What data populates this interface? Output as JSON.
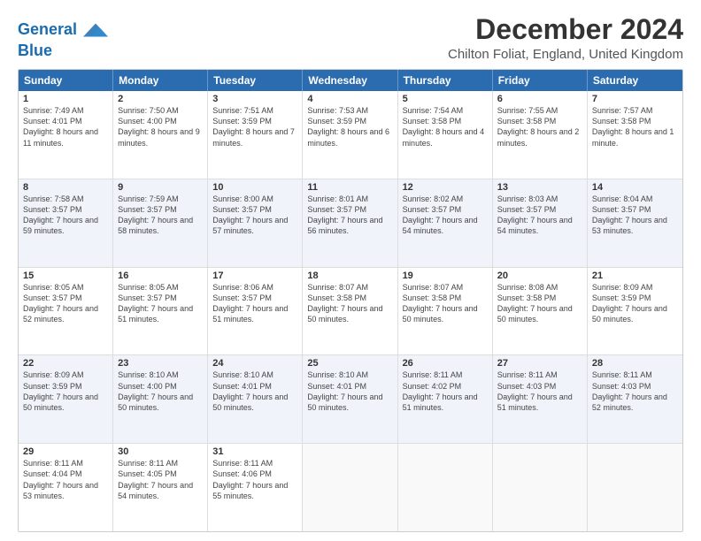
{
  "header": {
    "logo_line1": "General",
    "logo_line2": "Blue",
    "title": "December 2024",
    "subtitle": "Chilton Foliat, England, United Kingdom"
  },
  "calendar": {
    "headers": [
      "Sunday",
      "Monday",
      "Tuesday",
      "Wednesday",
      "Thursday",
      "Friday",
      "Saturday"
    ],
    "rows": [
      [
        {
          "day": "1",
          "sunrise": "Sunrise: 7:49 AM",
          "sunset": "Sunset: 4:01 PM",
          "daylight": "Daylight: 8 hours and 11 minutes."
        },
        {
          "day": "2",
          "sunrise": "Sunrise: 7:50 AM",
          "sunset": "Sunset: 4:00 PM",
          "daylight": "Daylight: 8 hours and 9 minutes."
        },
        {
          "day": "3",
          "sunrise": "Sunrise: 7:51 AM",
          "sunset": "Sunset: 3:59 PM",
          "daylight": "Daylight: 8 hours and 7 minutes."
        },
        {
          "day": "4",
          "sunrise": "Sunrise: 7:53 AM",
          "sunset": "Sunset: 3:59 PM",
          "daylight": "Daylight: 8 hours and 6 minutes."
        },
        {
          "day": "5",
          "sunrise": "Sunrise: 7:54 AM",
          "sunset": "Sunset: 3:58 PM",
          "daylight": "Daylight: 8 hours and 4 minutes."
        },
        {
          "day": "6",
          "sunrise": "Sunrise: 7:55 AM",
          "sunset": "Sunset: 3:58 PM",
          "daylight": "Daylight: 8 hours and 2 minutes."
        },
        {
          "day": "7",
          "sunrise": "Sunrise: 7:57 AM",
          "sunset": "Sunset: 3:58 PM",
          "daylight": "Daylight: 8 hours and 1 minute."
        }
      ],
      [
        {
          "day": "8",
          "sunrise": "Sunrise: 7:58 AM",
          "sunset": "Sunset: 3:57 PM",
          "daylight": "Daylight: 7 hours and 59 minutes."
        },
        {
          "day": "9",
          "sunrise": "Sunrise: 7:59 AM",
          "sunset": "Sunset: 3:57 PM",
          "daylight": "Daylight: 7 hours and 58 minutes."
        },
        {
          "day": "10",
          "sunrise": "Sunrise: 8:00 AM",
          "sunset": "Sunset: 3:57 PM",
          "daylight": "Daylight: 7 hours and 57 minutes."
        },
        {
          "day": "11",
          "sunrise": "Sunrise: 8:01 AM",
          "sunset": "Sunset: 3:57 PM",
          "daylight": "Daylight: 7 hours and 56 minutes."
        },
        {
          "day": "12",
          "sunrise": "Sunrise: 8:02 AM",
          "sunset": "Sunset: 3:57 PM",
          "daylight": "Daylight: 7 hours and 54 minutes."
        },
        {
          "day": "13",
          "sunrise": "Sunrise: 8:03 AM",
          "sunset": "Sunset: 3:57 PM",
          "daylight": "Daylight: 7 hours and 54 minutes."
        },
        {
          "day": "14",
          "sunrise": "Sunrise: 8:04 AM",
          "sunset": "Sunset: 3:57 PM",
          "daylight": "Daylight: 7 hours and 53 minutes."
        }
      ],
      [
        {
          "day": "15",
          "sunrise": "Sunrise: 8:05 AM",
          "sunset": "Sunset: 3:57 PM",
          "daylight": "Daylight: 7 hours and 52 minutes."
        },
        {
          "day": "16",
          "sunrise": "Sunrise: 8:05 AM",
          "sunset": "Sunset: 3:57 PM",
          "daylight": "Daylight: 7 hours and 51 minutes."
        },
        {
          "day": "17",
          "sunrise": "Sunrise: 8:06 AM",
          "sunset": "Sunset: 3:57 PM",
          "daylight": "Daylight: 7 hours and 51 minutes."
        },
        {
          "day": "18",
          "sunrise": "Sunrise: 8:07 AM",
          "sunset": "Sunset: 3:58 PM",
          "daylight": "Daylight: 7 hours and 50 minutes."
        },
        {
          "day": "19",
          "sunrise": "Sunrise: 8:07 AM",
          "sunset": "Sunset: 3:58 PM",
          "daylight": "Daylight: 7 hours and 50 minutes."
        },
        {
          "day": "20",
          "sunrise": "Sunrise: 8:08 AM",
          "sunset": "Sunset: 3:58 PM",
          "daylight": "Daylight: 7 hours and 50 minutes."
        },
        {
          "day": "21",
          "sunrise": "Sunrise: 8:09 AM",
          "sunset": "Sunset: 3:59 PM",
          "daylight": "Daylight: 7 hours and 50 minutes."
        }
      ],
      [
        {
          "day": "22",
          "sunrise": "Sunrise: 8:09 AM",
          "sunset": "Sunset: 3:59 PM",
          "daylight": "Daylight: 7 hours and 50 minutes."
        },
        {
          "day": "23",
          "sunrise": "Sunrise: 8:10 AM",
          "sunset": "Sunset: 4:00 PM",
          "daylight": "Daylight: 7 hours and 50 minutes."
        },
        {
          "day": "24",
          "sunrise": "Sunrise: 8:10 AM",
          "sunset": "Sunset: 4:01 PM",
          "daylight": "Daylight: 7 hours and 50 minutes."
        },
        {
          "day": "25",
          "sunrise": "Sunrise: 8:10 AM",
          "sunset": "Sunset: 4:01 PM",
          "daylight": "Daylight: 7 hours and 50 minutes."
        },
        {
          "day": "26",
          "sunrise": "Sunrise: 8:11 AM",
          "sunset": "Sunset: 4:02 PM",
          "daylight": "Daylight: 7 hours and 51 minutes."
        },
        {
          "day": "27",
          "sunrise": "Sunrise: 8:11 AM",
          "sunset": "Sunset: 4:03 PM",
          "daylight": "Daylight: 7 hours and 51 minutes."
        },
        {
          "day": "28",
          "sunrise": "Sunrise: 8:11 AM",
          "sunset": "Sunset: 4:03 PM",
          "daylight": "Daylight: 7 hours and 52 minutes."
        }
      ],
      [
        {
          "day": "29",
          "sunrise": "Sunrise: 8:11 AM",
          "sunset": "Sunset: 4:04 PM",
          "daylight": "Daylight: 7 hours and 53 minutes."
        },
        {
          "day": "30",
          "sunrise": "Sunrise: 8:11 AM",
          "sunset": "Sunset: 4:05 PM",
          "daylight": "Daylight: 7 hours and 54 minutes."
        },
        {
          "day": "31",
          "sunrise": "Sunrise: 8:11 AM",
          "sunset": "Sunset: 4:06 PM",
          "daylight": "Daylight: 7 hours and 55 minutes."
        },
        null,
        null,
        null,
        null
      ]
    ]
  }
}
